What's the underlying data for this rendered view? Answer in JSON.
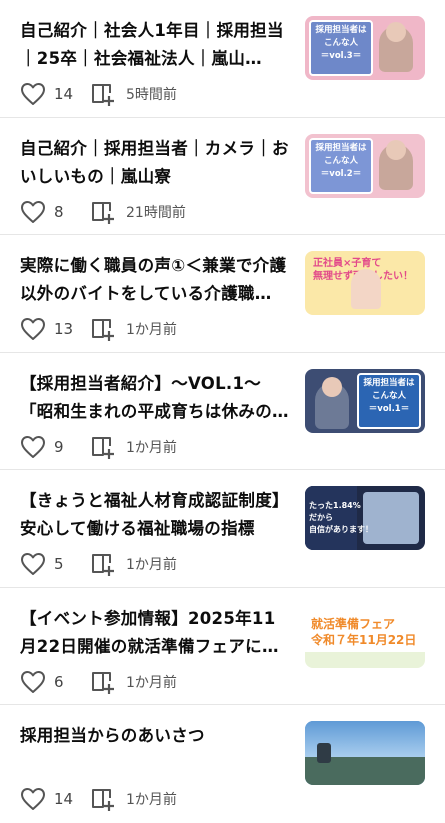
{
  "articles": [
    {
      "title": "自己紹介｜社会人1年目｜採用担当｜25卒｜社会福祉法人｜嵐山…",
      "likes": "14",
      "time": "5時間前",
      "thumb": {
        "bg": "#f0b7c8",
        "panel": "#6e88c9",
        "text": "採用担当者は\nこんな人\n＝vol.3＝"
      }
    },
    {
      "title": "自己紹介｜採用担当者｜カメラ｜おいしいもの｜嵐山寮",
      "likes": "8",
      "time": "21時間前",
      "thumb": {
        "bg": "#f2c2cf",
        "panel": "#7d96d6",
        "text": "採用担当者は\nこんな人\n＝vol.2＝"
      }
    },
    {
      "title": "実際に働く職員の声①＜兼業で介護以外のバイトをしている介護職…",
      "likes": "13",
      "time": "1か月前",
      "thumb": {
        "bg": "#fbe8a8",
        "panel": "#ffffff",
        "text": "正社員×子育て\n無理せず両立したい！"
      }
    },
    {
      "title": "【採用担当者紹介】～VOL.1～「昭和生まれの平成育ちは休みの日…",
      "likes": "9",
      "time": "1か月前",
      "thumb": {
        "bg": "#3d4d73",
        "panel": "#2b65b3",
        "text": "採用担当者は\nこんな人\n＝vol.1＝"
      }
    },
    {
      "title": "【きょうと福祉人材育成認証制度】安心して働ける福祉職場の指標",
      "likes": "5",
      "time": "1か月前",
      "thumb": {
        "bg": "#1f2a47",
        "panel": "#ffffff",
        "text": "たった1.84%\nだから\n自信があります！"
      }
    },
    {
      "title": "【イベント参加情報】2025年11月22日開催の就活準備フェアに参…",
      "likes": "6",
      "time": "1か月前",
      "thumb": {
        "bg": "#ffffff",
        "panel": "#f08a2a",
        "text": "就活準備フェア\n令和７年11月22日"
      }
    },
    {
      "title": "採用担当からのあいさつ",
      "likes": "14",
      "time": "1か月前",
      "thumb": {
        "bg": "#6fa6da",
        "panel": "#cfe3f4",
        "text": ""
      }
    }
  ]
}
